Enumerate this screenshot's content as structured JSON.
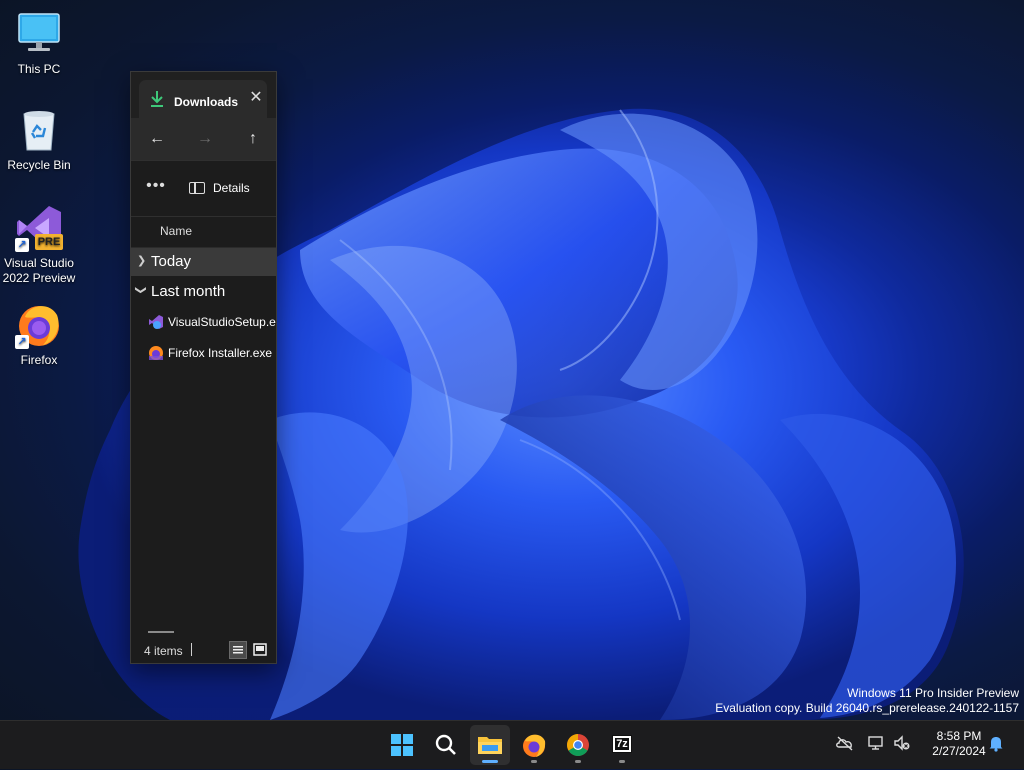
{
  "desktop": {
    "icons": [
      {
        "label": "This PC"
      },
      {
        "label": "Recycle Bin"
      },
      {
        "label": "Visual Studio 2022 Preview",
        "line1": "Visual Studio",
        "line2": "2022 Preview",
        "badge": "PRE"
      },
      {
        "label": "Firefox"
      }
    ]
  },
  "explorer": {
    "tab_title": "Downloads",
    "nav": {
      "back": "←",
      "forward": "→",
      "up": "↑"
    },
    "command_bar": {
      "more_label": "•••",
      "details_label": "Details"
    },
    "column_header": "Name",
    "groups": [
      {
        "label": "Today",
        "expanded": false
      },
      {
        "label": "Last month",
        "expanded": true
      }
    ],
    "files": [
      {
        "name": "VisualStudioSetup.exe",
        "icon": "visual-studio-installer-icon"
      },
      {
        "name": "Firefox Installer.exe",
        "icon": "firefox-installer-icon"
      }
    ],
    "status": {
      "item_count": "4 items"
    }
  },
  "watermark": {
    "line1": "Windows 11 Pro Insider Preview",
    "line2": "Evaluation copy. Build 26040.rs_prerelease.240122-1157"
  },
  "taskbar": {
    "apps": [
      "start-icon",
      "search-icon",
      "file-explorer-icon",
      "firefox-icon",
      "chrome-icon",
      "7zip-icon"
    ],
    "sevenzip_label": "7z",
    "clock": {
      "time": "8:58 PM",
      "date": "2/27/2024"
    }
  },
  "colors": {
    "accent": "#5fb0ff",
    "window_bg": "#1c1c1c",
    "taskbar_bg": "#1c1c1e"
  }
}
